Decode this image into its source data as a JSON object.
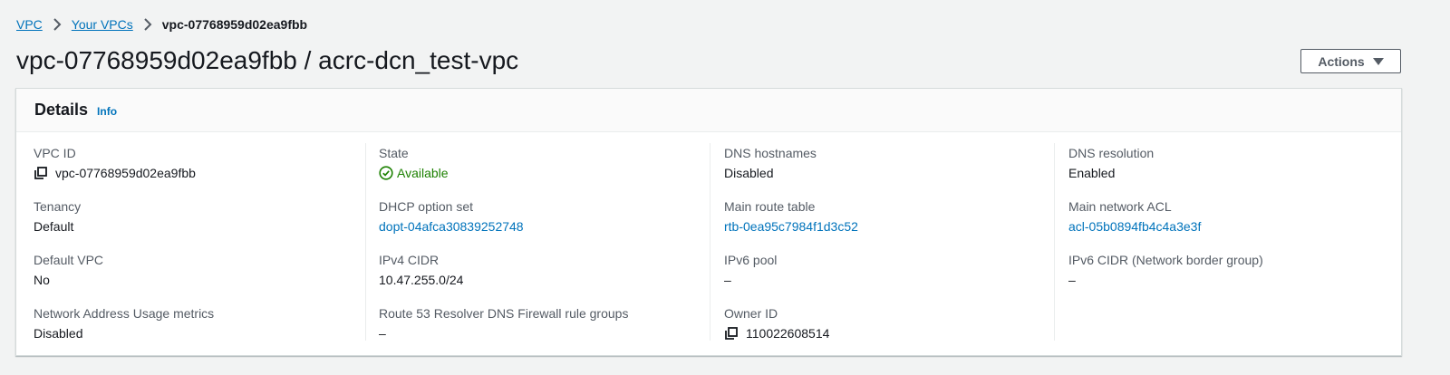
{
  "breadcrumb": {
    "items": [
      "VPC",
      "Your VPCs"
    ],
    "current": "vpc-07768959d02ea9fbb"
  },
  "page": {
    "title": "vpc-07768959d02ea9fbb / acrc-dcn_test-vpc",
    "actions_label": "Actions"
  },
  "details": {
    "title": "Details",
    "info_label": "Info",
    "columns": [
      [
        {
          "label": "VPC ID",
          "value": "vpc-07768959d02ea9fbb",
          "copyable": true
        },
        {
          "label": "Tenancy",
          "value": "Default"
        },
        {
          "label": "Default VPC",
          "value": "No"
        },
        {
          "label": "Network Address Usage metrics",
          "value": "Disabled"
        }
      ],
      [
        {
          "label": "State",
          "value": "Available",
          "status": "success"
        },
        {
          "label": "DHCP option set",
          "value": "dopt-04afca30839252748",
          "link": true
        },
        {
          "label": "IPv4 CIDR",
          "value": "10.47.255.0/24"
        },
        {
          "label": "Route 53 Resolver DNS Firewall rule groups",
          "value": "–"
        }
      ],
      [
        {
          "label": "DNS hostnames",
          "value": "Disabled"
        },
        {
          "label": "Main route table",
          "value": "rtb-0ea95c7984f1d3c52",
          "link": true
        },
        {
          "label": "IPv6 pool",
          "value": "–"
        },
        {
          "label": "Owner ID",
          "value": "110022608514",
          "copyable": true
        }
      ],
      [
        {
          "label": "DNS resolution",
          "value": "Enabled"
        },
        {
          "label": "Main network ACL",
          "value": "acl-05b0894fb4c4a3e3f",
          "link": true
        },
        {
          "label": "IPv6 CIDR (Network border group)",
          "value": "–"
        }
      ]
    ]
  },
  "colors": {
    "link": "#0073bb",
    "success": "#1d8102",
    "label": "#545b64",
    "text": "#16191f"
  },
  "icons": {
    "breadcrumb_separator": "chevron-right-icon",
    "copy": "copy-icon",
    "status": "check-circle-icon",
    "actions": "caret-down-icon"
  }
}
